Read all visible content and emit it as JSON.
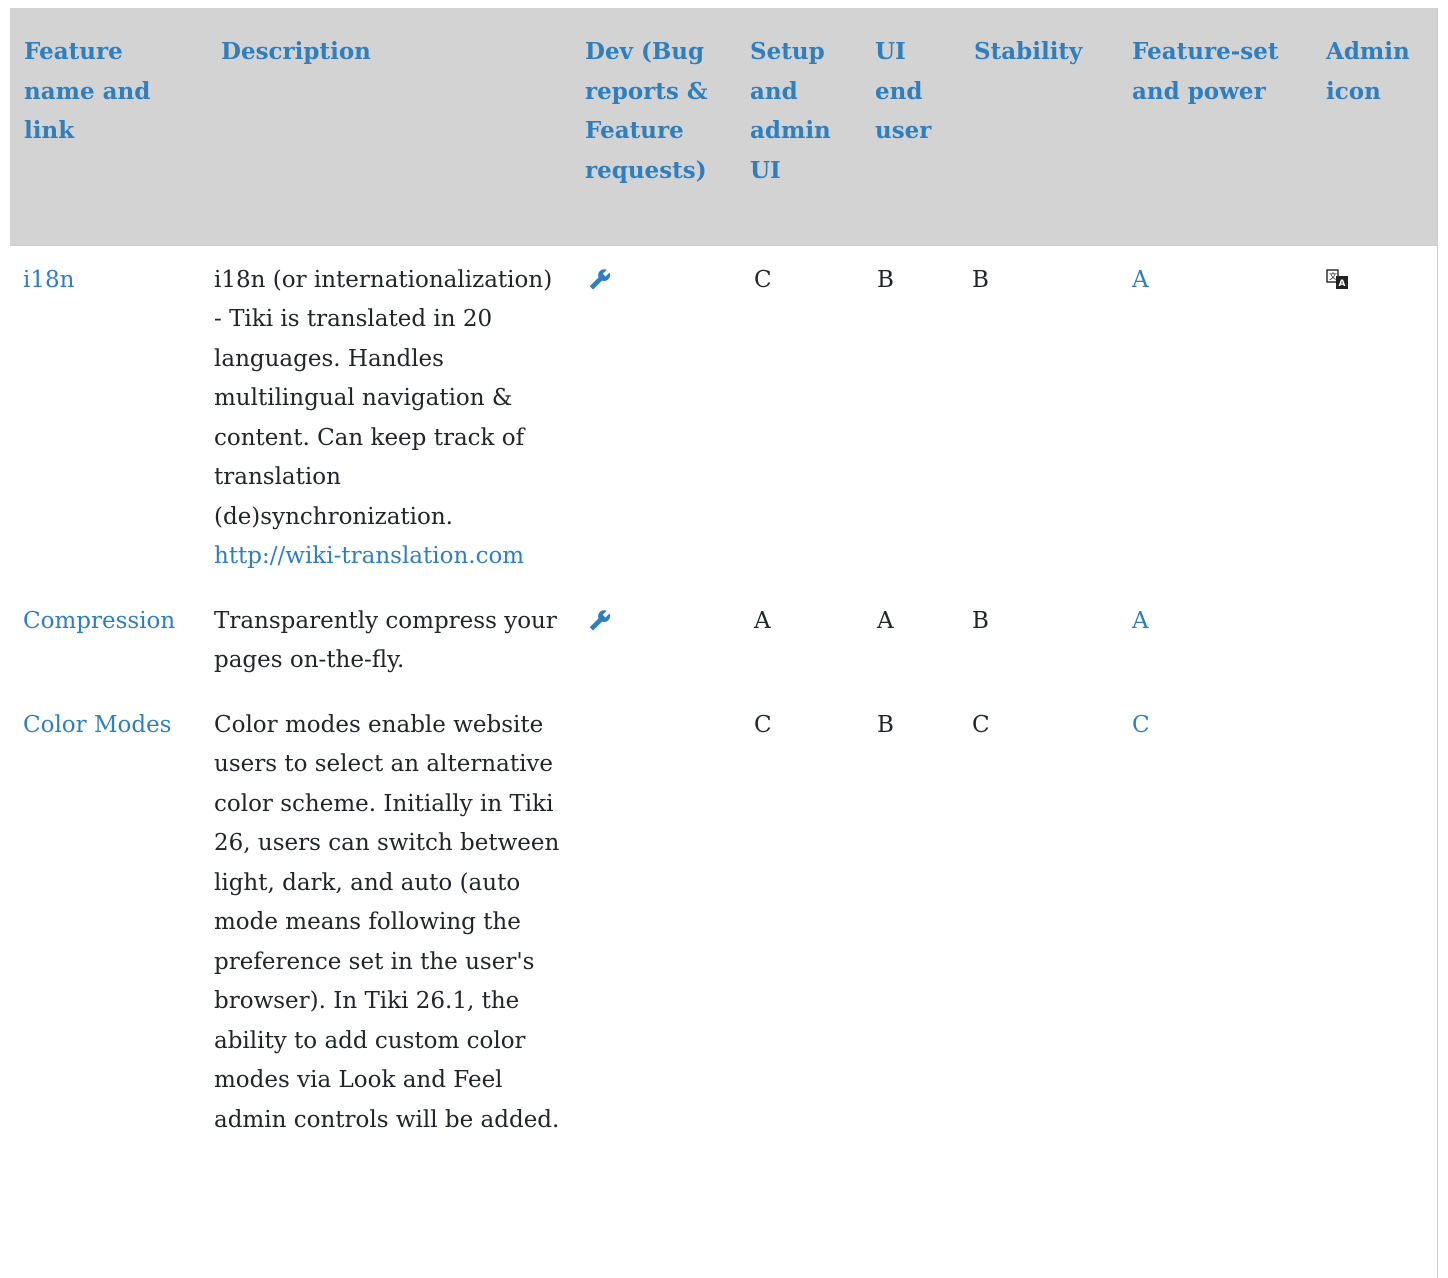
{
  "table": {
    "headers": [
      "Feature name and link",
      "Description",
      "Dev (Bug reports & Feature requests)",
      "Setup and admin UI",
      "UI end user",
      "Stability",
      "Feature-set and power",
      "Admin icon"
    ],
    "rows": [
      {
        "feature": "i18n",
        "description": "i18n (or internationalization) - Tiki is translated in 20 languages. Handles multilingual navigation & content. Can keep track of translation (de)synchronization.",
        "description_link": "http://wiki-translation.com",
        "dev_icon": "wrench-icon",
        "setup": "C",
        "ui_end_user": "B",
        "stability": "B",
        "feature_set": "A",
        "admin_icon": "language-icon"
      },
      {
        "feature": "Compression",
        "description": "Transparently compress your pages on-the-fly.",
        "dev_icon": "wrench-icon",
        "setup": "A",
        "ui_end_user": "A",
        "stability": "B",
        "feature_set": "A"
      },
      {
        "feature": "Color Modes",
        "description": "Color modes enable website users to select an alternative color scheme. Initially in Tiki 26, users can switch between light, dark, and auto (auto mode means following the preference set in the user's browser). In Tiki 26.1, the ability to add custom color modes via Look and Feel admin controls will be added.",
        "setup": "C",
        "ui_end_user": "B",
        "stability": "C",
        "feature_set": "C"
      }
    ]
  },
  "colors": {
    "header_bg": "#d3d3d3",
    "link": "#2f7fbf",
    "text": "#212529"
  }
}
